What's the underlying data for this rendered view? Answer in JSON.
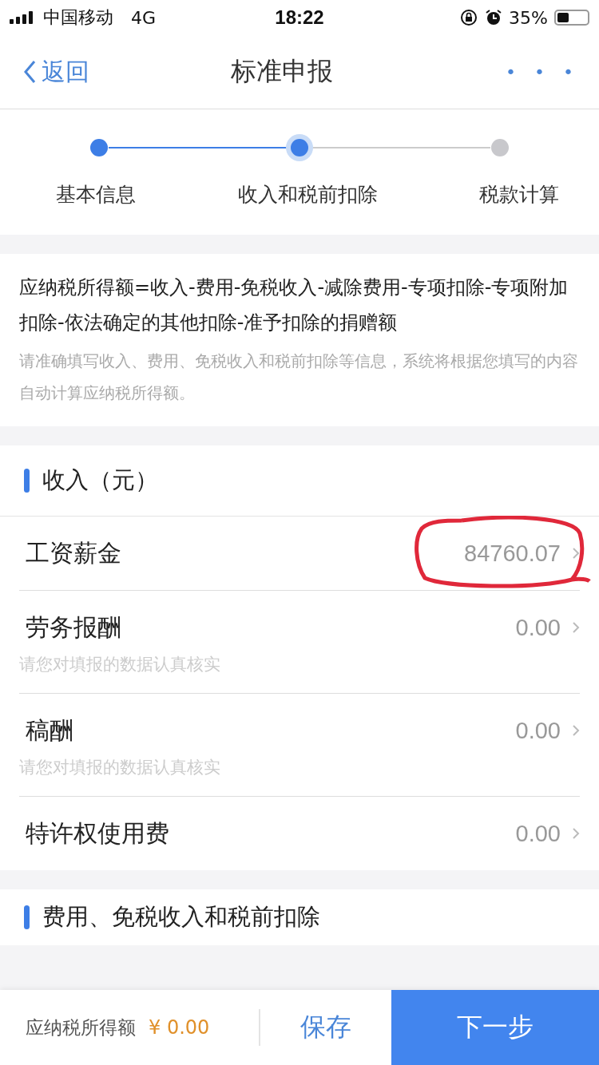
{
  "status_bar": {
    "carrier": "中国移动",
    "network": "4G",
    "time": "18:22",
    "battery": "35%"
  },
  "nav": {
    "back": "返回",
    "title": "标准申报",
    "more": "• • •"
  },
  "steps": [
    {
      "label": "基本信息",
      "done": true,
      "selected": false
    },
    {
      "label": "收入和税前扣除",
      "done": false,
      "selected": true
    },
    {
      "label": "税款计算",
      "done": false,
      "selected": false
    }
  ],
  "formula": "应纳税所得额=收入-费用-免税收入-减除费用-专项扣除-专项附加扣除-依法确定的其他扣除-准予扣除的捐赠额",
  "formula_note": "请准确填写收入、费用、免税收入和税前扣除等信息，系统将根据您填写的内容自动计算应纳税所得额。",
  "income": {
    "title": "收入（元）",
    "rows": [
      {
        "label": "工资薪金",
        "value": "84760.07",
        "circled": true
      },
      {
        "label": "劳务报酬",
        "value": "0.00",
        "hint": "请您对填报的数据认真核实",
        "circled": false
      },
      {
        "label": "稿酬",
        "value": "0.00",
        "hint": "请您对填报的数据认真核实",
        "circled": false
      },
      {
        "label": "特许权使用费",
        "value": "0.00",
        "circled": false
      }
    ]
  },
  "next_section": {
    "title": "费用、免税收入和税前扣除"
  },
  "footer": {
    "label": "应纳税所得额",
    "amount": "¥ 0.00",
    "save": "保存",
    "next": "下一步"
  }
}
